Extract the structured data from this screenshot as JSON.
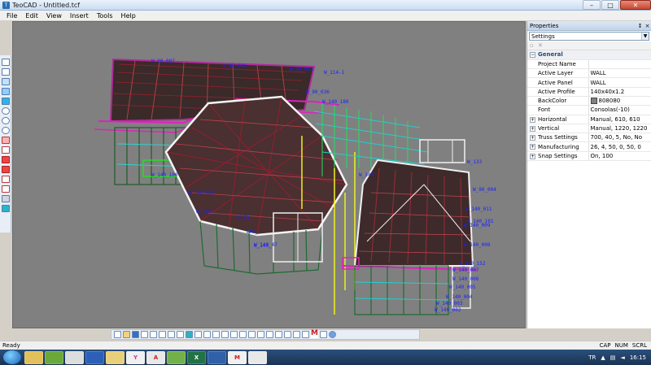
{
  "window": {
    "title": "TeoCAD - Untitled.tcf",
    "app_icon": "teocad-icon"
  },
  "menu": [
    "File",
    "Edit",
    "View",
    "Insert",
    "Tools",
    "Help"
  ],
  "viewport": {
    "background": "#808080",
    "labels": [
      "W_90_007",
      "W_90_008",
      "W_90_001",
      "W_114-1",
      "W_90_036",
      "W_140_180",
      "W_140_038",
      "W_140_",
      "W_133",
      "W_90_004",
      "W_140_011",
      "W_140_101",
      "W_140_009",
      "W_140_008",
      "W_140_152",
      "W_140_007",
      "W_140_006",
      "W_140_005",
      "W_140_004",
      "W_140_003",
      "W_140_002",
      "W_140_",
      "W_140_47",
      "W_140_",
      "140_",
      "W_36",
      "W_140_100"
    ]
  },
  "properties": {
    "title": "Properties",
    "pin": "↕",
    "close": "×",
    "selector": "Settings",
    "category": "General",
    "rows": [
      {
        "key": "Project Name",
        "value": ""
      },
      {
        "key": "Active Layer",
        "value": "WALL"
      },
      {
        "key": "Active Panel",
        "value": "WALL"
      },
      {
        "key": "Active Profile",
        "value": "140x40x1.2"
      },
      {
        "key": "BackColor",
        "value": "808080",
        "swatch": true
      },
      {
        "key": "Font",
        "value": "Consolas(-10)"
      },
      {
        "key": "Horizontal",
        "value": "Manual, 610, 610",
        "expandable": true
      },
      {
        "key": "Vertical",
        "value": "Manual, 1220, 1220",
        "expandable": true
      },
      {
        "key": "Truss Settings",
        "value": "700, 40, 5, No, No",
        "expandable": true
      },
      {
        "key": "Manufacturing",
        "value": "26, 4, 50, 0, 50, 0",
        "expandable": true
      },
      {
        "key": "Snap Settings",
        "value": "On, 100",
        "expandable": true
      }
    ]
  },
  "status": {
    "text": "Ready",
    "caps": "CAP",
    "num": "NUM",
    "scrl": "SCRL"
  },
  "taskbar": {
    "lang": "TR",
    "time": "16:15",
    "apps": [
      "Y",
      "A",
      "X",
      "M"
    ]
  },
  "bottom_toolbar": {
    "red_m": "M"
  }
}
